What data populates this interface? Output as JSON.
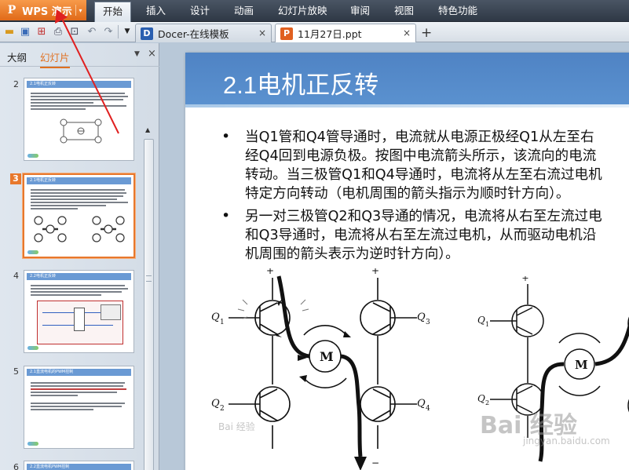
{
  "app": {
    "name": "WPS 演示",
    "logo_letter": "P",
    "accent": "#e8782c"
  },
  "menu": [
    "开始",
    "插入",
    "设计",
    "动画",
    "幻灯片放映",
    "审阅",
    "视图",
    "特色功能"
  ],
  "menu_active_index": 0,
  "toolbar_icons": [
    "open-folder-icon",
    "save-icon",
    "export-pdf-icon",
    "print-icon",
    "print-preview-icon",
    "undo-icon",
    "redo-icon",
    "dropdown-icon"
  ],
  "tabs": [
    {
      "label": "Docer-在线模板",
      "icon": "docer-icon",
      "close": "×"
    },
    {
      "label": "11月27日.ppt",
      "icon": "ppt-icon",
      "close": "×"
    }
  ],
  "tab_add": "+",
  "panel": {
    "tab_outline": "大纲",
    "tab_slides": "幻灯片",
    "down": "▼",
    "close": "×"
  },
  "thumbnails": [
    {
      "num": "2",
      "title": "2.1电机正反转",
      "selected": false
    },
    {
      "num": "3",
      "title": "2.1电机正反转",
      "selected": true
    },
    {
      "num": "4",
      "title": "2.2电机正反转",
      "selected": false
    },
    {
      "num": "5",
      "title": "2.1直流电机的PWM控制",
      "selected": false
    },
    {
      "num": "6",
      "title": "2.2直流电机PWM控制",
      "selected": false
    }
  ],
  "slide": {
    "title": "2.1电机正反转",
    "bullet_char": "•",
    "paragraph1": [
      "当Q1管和Q4管导通时，电流就从电源正极经Q1从左至右",
      "经Q4回到电源负极。按图中电流箭头所示，该流向的电流",
      "转动。当三极管Q1和Q4导通时，电流将从左至右流过电机",
      "特定方向转动（电机周围的箭头指示为顺时针方向）。"
    ],
    "paragraph2": [
      "另一对三极管Q2和Q3导通的情况，电流将从右至左流过电",
      "和Q3导通时，电流将从右至左流过电机，从而驱动电机沿",
      "机周围的箭头表示为逆时针方向）。"
    ],
    "circuit_labels": {
      "motor": "M",
      "plus": "+",
      "minus": "−",
      "q1": "Q",
      "q1s": "1",
      "q2": "Q",
      "q2s": "2",
      "q3": "Q",
      "q3s": "3",
      "q4": "Q",
      "q4s": "4"
    }
  },
  "watermarks": {
    "main": "Bai 经验",
    "url": "jingyan.baidu.com",
    "small": "Bai 经验"
  }
}
